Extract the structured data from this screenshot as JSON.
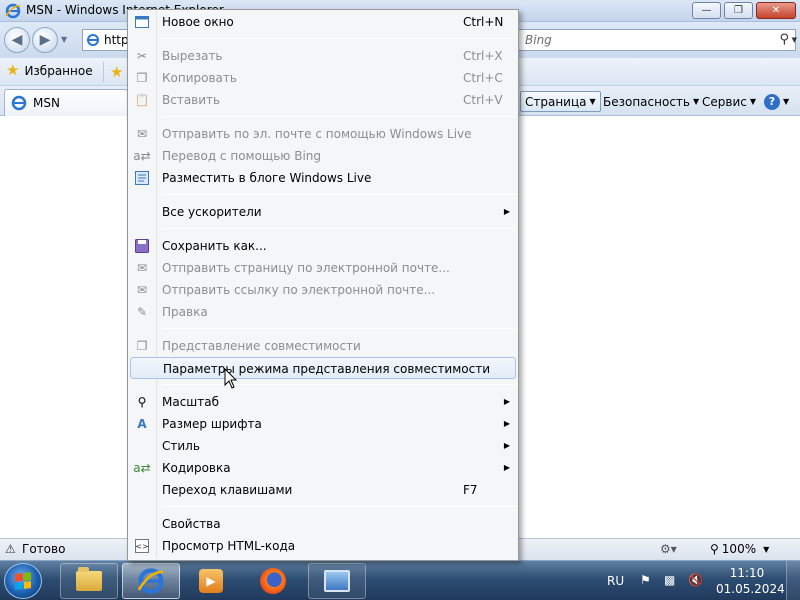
{
  "window": {
    "title": "MSN - Windows Internet Explorer",
    "controls": [
      "minimize",
      "maximize",
      "close"
    ]
  },
  "address_bar": {
    "url_visible": "http",
    "search_placeholder": "Bing"
  },
  "favorites_bar": {
    "favorites_label": "Избранное"
  },
  "tab": {
    "title": "MSN"
  },
  "command_bar": {
    "page_label": "Страница",
    "safety_label": "Безопасность",
    "tools_label": "Сервис"
  },
  "status_bar": {
    "status_text": "Готово",
    "zoom_label": "100%"
  },
  "context_menu": {
    "items": [
      {
        "label": "Новое окно",
        "shortcut": "Ctrl+N",
        "icon": "new-window-icon",
        "disabled": false,
        "submenu": false
      },
      {
        "label": "Вырезать",
        "shortcut": "Ctrl+X",
        "icon": "scissors-icon",
        "disabled": true,
        "submenu": false
      },
      {
        "label": "Копировать",
        "shortcut": "Ctrl+C",
        "icon": "copy-icon",
        "disabled": true,
        "submenu": false
      },
      {
        "label": "Вставить",
        "shortcut": "Ctrl+V",
        "icon": "paste-icon",
        "disabled": true,
        "submenu": false
      },
      {
        "label": "Отправить по эл. почте с помощью Windows Live",
        "shortcut": "",
        "icon": "email-live-icon",
        "disabled": true,
        "submenu": false
      },
      {
        "label": "Перевод с помощью Bing",
        "shortcut": "",
        "icon": "translate-icon",
        "disabled": true,
        "submenu": false
      },
      {
        "label": "Разместить в блоге Windows Live",
        "shortcut": "",
        "icon": "blog-icon",
        "disabled": false,
        "submenu": false
      },
      {
        "label": "Все ускорители",
        "shortcut": "",
        "icon": "",
        "disabled": false,
        "submenu": true
      },
      {
        "label": "Сохранить как...",
        "shortcut": "",
        "icon": "save-icon",
        "disabled": false,
        "submenu": false
      },
      {
        "label": "Отправить страницу по электронной почте...",
        "shortcut": "",
        "icon": "send-page-icon",
        "disabled": true,
        "submenu": false
      },
      {
        "label": "Отправить ссылку по электронной почте...",
        "shortcut": "",
        "icon": "send-link-icon",
        "disabled": true,
        "submenu": false
      },
      {
        "label": "Правка",
        "shortcut": "",
        "icon": "pencil-icon",
        "disabled": true,
        "submenu": false
      },
      {
        "label": "Представление совместимости",
        "shortcut": "",
        "icon": "compat-view-icon",
        "disabled": true,
        "submenu": false
      },
      {
        "label": "Параметры режима представления совместимости",
        "shortcut": "",
        "icon": "",
        "disabled": false,
        "submenu": false
      },
      {
        "label": "Масштаб",
        "shortcut": "",
        "icon": "zoom-icon",
        "disabled": false,
        "submenu": true
      },
      {
        "label": "Размер шрифта",
        "shortcut": "",
        "icon": "font-size-icon",
        "disabled": false,
        "submenu": true
      },
      {
        "label": "Стиль",
        "shortcut": "",
        "icon": "",
        "disabled": false,
        "submenu": true
      },
      {
        "label": "Кодировка",
        "shortcut": "",
        "icon": "encoding-icon",
        "disabled": false,
        "submenu": true
      },
      {
        "label": "Переход клавишами",
        "shortcut": "F7",
        "icon": "",
        "disabled": false,
        "submenu": false
      },
      {
        "label": "Свойства",
        "shortcut": "",
        "icon": "",
        "disabled": false,
        "submenu": false
      },
      {
        "label": "Просмотр HTML-кода",
        "shortcut": "",
        "icon": "view-source-icon",
        "disabled": false,
        "submenu": false
      }
    ],
    "highlighted_item": "Параметры режима представления совместимости"
  },
  "taskbar": {
    "language": "RU",
    "time": "11:10",
    "date": "01.05.2024",
    "pinned": [
      "windows-explorer-icon",
      "internet-explorer-icon",
      "media-player-icon",
      "firefox-icon",
      "remote-desktop-icon"
    ]
  },
  "colors": {
    "menu_background": "#f5f6f7",
    "disabled_text": "#8d8d8d",
    "highlight_border": "#a9c3e6",
    "taskbar": "#2e4d72"
  }
}
